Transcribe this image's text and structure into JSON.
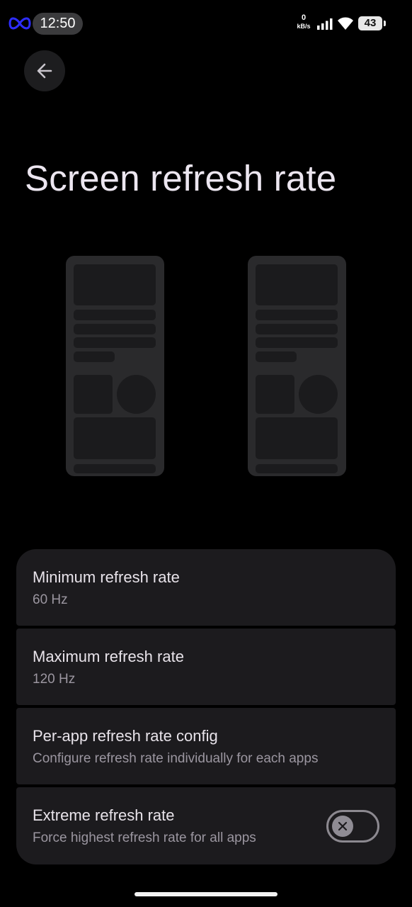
{
  "status_bar": {
    "time": "12:50",
    "net_speed_value": "0",
    "net_speed_unit": "kB/s",
    "battery": "43",
    "icons": [
      "infinity-icon",
      "signal-icon",
      "wifi-icon",
      "battery-icon"
    ]
  },
  "header": {
    "back_icon": "arrow-left-icon",
    "title": "Screen refresh rate"
  },
  "settings": {
    "items": [
      {
        "title": "Minimum refresh rate",
        "subtitle": "60 Hz"
      },
      {
        "title": "Maximum refresh rate",
        "subtitle": "120 Hz"
      },
      {
        "title": "Per-app refresh rate config",
        "subtitle": "Configure refresh rate individually for each apps"
      },
      {
        "title": "Extreme refresh rate",
        "subtitle": "Force highest refresh rate for all apps",
        "toggle_on": false
      }
    ]
  },
  "colors": {
    "background": "#000000",
    "card": "#1c1b1e",
    "illustration": "#2a2a2c"
  }
}
